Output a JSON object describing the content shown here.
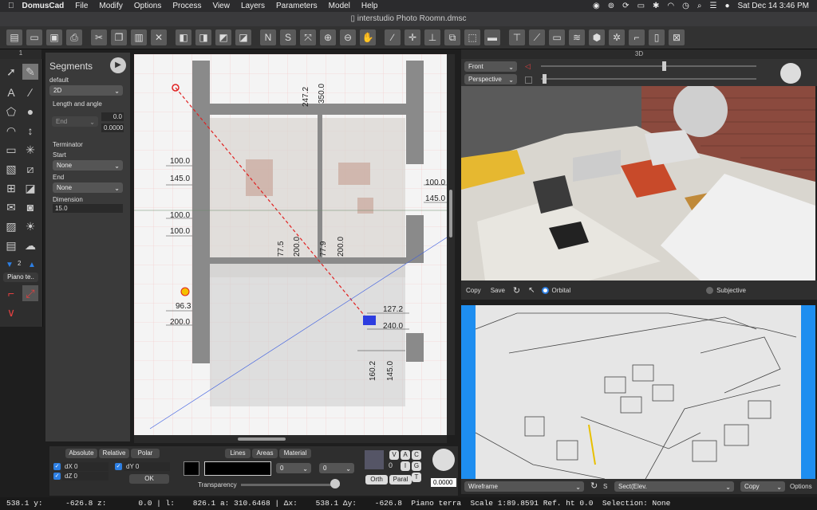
{
  "menubar": {
    "apple": "",
    "app_name": "DomusCad",
    "items": [
      "File",
      "Modify",
      "Options",
      "Process",
      "View",
      "Layers",
      "Parameters",
      "Model",
      "Help"
    ],
    "clock": "Sat Dec 14  3:46 PM"
  },
  "window": {
    "title": "interstudio Photo Roomn.dmsc"
  },
  "left_tab": "1",
  "segments": {
    "title": "Segments",
    "style_label": "default",
    "style_value": "2D",
    "length_angle": "Length and angle",
    "end_value": "End",
    "len1": "0.0",
    "len2": "0.0000",
    "terminator": "Terminator",
    "start_label": "Start",
    "start_value": "None",
    "end_label": "End",
    "end_sel_value": "None",
    "dimension_label": "Dimension",
    "dimension_value": "15.0"
  },
  "palette": {
    "layer_num": "2",
    "floor_label": "Piano te.."
  },
  "plan_dims": {
    "d247": "247.2",
    "d350": "350.0",
    "d100a": "100.0",
    "d145a": "145.0",
    "d100b": "100.0",
    "d100c": "100.0",
    "d77": "77.5",
    "d200a": "200.0",
    "d77b": "77.9",
    "d200b": "200.0",
    "d100r": "100.0",
    "d145r": "145.0",
    "d96": "96.3",
    "d200c": "200.0",
    "d127": "127.2",
    "d240": "240.0",
    "d160": "160.2",
    "d145b": "145.0"
  },
  "view3d": {
    "header": "3D",
    "view_select": "Front",
    "proj_select": "Perspective",
    "copy": "Copy",
    "save": "Save",
    "orbital": "Orbital",
    "subjective": "Subjective"
  },
  "wireframe": {
    "mode": "Wireframe",
    "s_label": "S",
    "section": "Sect(Elev.",
    "copy": "Copy",
    "options": "Options"
  },
  "coords": {
    "absolute": "Absolute",
    "relative": "Relative",
    "polar": "Polar",
    "dx": "dX 0",
    "dy": "dY 0",
    "dz": "dZ 0",
    "ok": "OK"
  },
  "style_panel": {
    "lines": "Lines",
    "areas": "Areas",
    "material": "Material",
    "combo1": "0",
    "combo2": "0",
    "transparency": "Transparency"
  },
  "snap_panel": {
    "v": "V",
    "a": "A",
    "c": "C",
    "i": "I",
    "g": "G",
    "t": "T",
    "orth": "Orth",
    "paral": "Paral",
    "zero": "0",
    "knob_value": "0.0000"
  },
  "status": "538.1 y:     -626.8 z:       0.0 | l:    826.1 a: 310.6468 | Δx:    538.1 Δy:    -626.8  Piano terra  Scale 1:89.8591 Ref. ht 0.0  Selection: None",
  "colors": {
    "accent": "#2d7fe3",
    "dashline": "#e02020",
    "wall": "#888888"
  }
}
